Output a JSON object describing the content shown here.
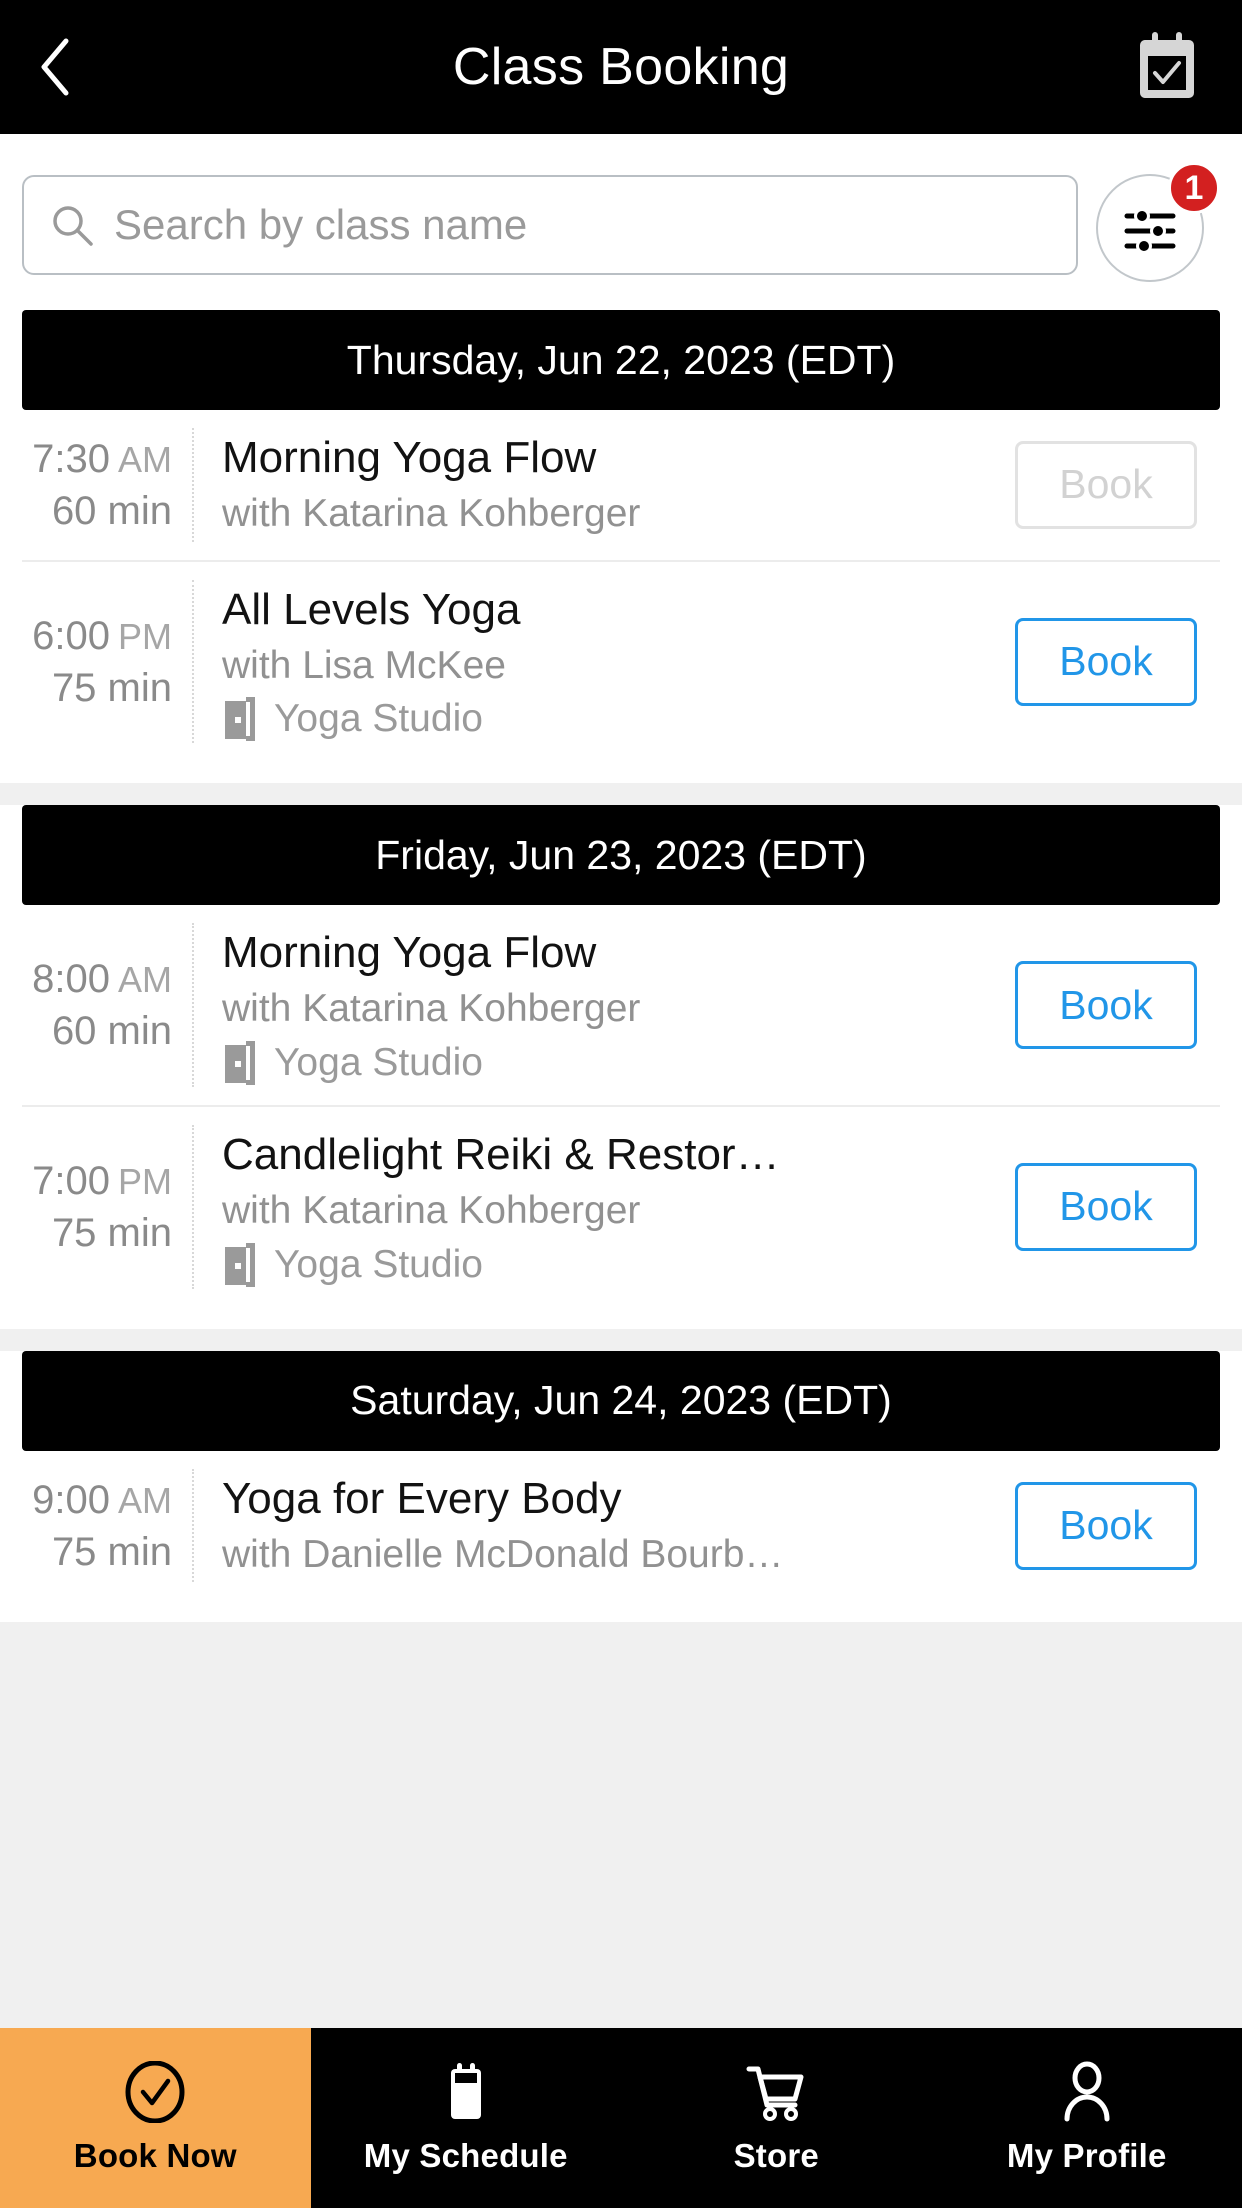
{
  "header": {
    "title": "Class Booking",
    "back_icon": "chevron-left-icon",
    "calendar_icon": "calendar-check-icon"
  },
  "search": {
    "placeholder": "Search by class name",
    "value": "",
    "icon": "search-icon",
    "filter_icon": "tune-sliders-icon",
    "filter_badge": "1",
    "badge_color": "#d32020"
  },
  "colors": {
    "accent_blue": "#2196e8",
    "active_nav": "#f7a951",
    "header_bg": "#000000",
    "disabled_grey": "#d2d2d2"
  },
  "days": [
    {
      "label": "Thursday, Jun 22, 2023 (EDT)",
      "classes": [
        {
          "time": "7:30",
          "ampm": "AM",
          "duration": "60 min",
          "name": "Morning Yoga Flow",
          "teacher": "with Katarina Kohberger",
          "location": "",
          "book_label": "Book",
          "disabled": true
        },
        {
          "time": "6:00",
          "ampm": "PM",
          "duration": "75 min",
          "name": "All Levels Yoga",
          "teacher": "with Lisa McKee",
          "location": "Yoga Studio",
          "book_label": "Book",
          "disabled": false
        }
      ]
    },
    {
      "label": "Friday, Jun 23, 2023 (EDT)",
      "classes": [
        {
          "time": "8:00",
          "ampm": "AM",
          "duration": "60 min",
          "name": "Morning Yoga Flow",
          "teacher": "with Katarina Kohberger",
          "location": "Yoga Studio",
          "book_label": "Book",
          "disabled": false
        },
        {
          "time": "7:00",
          "ampm": "PM",
          "duration": "75 min",
          "name": "Candlelight Reiki & Restor…",
          "teacher": "with Katarina Kohberger",
          "location": "Yoga Studio",
          "book_label": "Book",
          "disabled": false
        }
      ]
    },
    {
      "label": "Saturday, Jun 24, 2023 (EDT)",
      "classes": [
        {
          "time": "9:00",
          "ampm": "AM",
          "duration": "75 min",
          "name": "Yoga for Every Body",
          "teacher": "with Danielle McDonald Bourb…",
          "location": "",
          "book_label": "Book",
          "disabled": false
        }
      ]
    }
  ],
  "bottom_nav": [
    {
      "label": "Book Now",
      "icon": "check-circle-icon",
      "active": true
    },
    {
      "label": "My Schedule",
      "icon": "calendar-icon",
      "active": false
    },
    {
      "label": "Store",
      "icon": "shopping-cart-icon",
      "active": false
    },
    {
      "label": "My Profile",
      "icon": "person-icon",
      "active": false
    }
  ]
}
